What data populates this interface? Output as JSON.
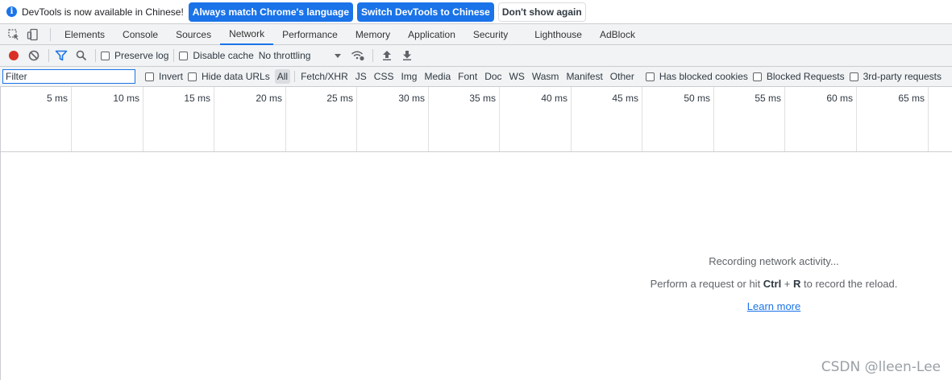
{
  "infobar": {
    "message": "DevTools is now available in Chinese!",
    "btn_match": "Always match Chrome's language",
    "btn_switch": "Switch DevTools to Chinese",
    "btn_dismiss": "Don't show again"
  },
  "tabs": [
    {
      "label": "Elements"
    },
    {
      "label": "Console"
    },
    {
      "label": "Sources"
    },
    {
      "label": "Network",
      "active": true
    },
    {
      "label": "Performance"
    },
    {
      "label": "Memory"
    },
    {
      "label": "Application"
    },
    {
      "label": "Security"
    },
    {
      "label": "Lighthouse"
    },
    {
      "label": "AdBlock"
    }
  ],
  "toolbar": {
    "preserve_log": "Preserve log",
    "disable_cache": "Disable cache",
    "throttling": "No throttling"
  },
  "filterbar": {
    "placeholder": "Filter",
    "invert": "Invert",
    "hide_data_urls": "Hide data URLs",
    "types": [
      "All",
      "Fetch/XHR",
      "JS",
      "CSS",
      "Img",
      "Media",
      "Font",
      "Doc",
      "WS",
      "Wasm",
      "Manifest",
      "Other"
    ],
    "selected_type": "All",
    "has_blocked_cookies": "Has blocked cookies",
    "blocked_requests": "Blocked Requests",
    "third_party": "3rd-party requests"
  },
  "timeline": {
    "ticks": [
      "5 ms",
      "10 ms",
      "15 ms",
      "20 ms",
      "25 ms",
      "30 ms",
      "35 ms",
      "40 ms",
      "45 ms",
      "50 ms",
      "55 ms",
      "60 ms",
      "65 ms"
    ]
  },
  "empty_state": {
    "recording": "Recording network activity...",
    "hint_prefix": "Perform a request or hit ",
    "ctrl": "Ctrl",
    "plus": " + ",
    "r": "R",
    "hint_suffix": " to record the reload.",
    "learn_more": "Learn more"
  },
  "watermark": "CSDN @lleen-Lee",
  "colors": {
    "accent": "#1a73e8",
    "record": "#d93025",
    "toolbar_bg": "#f1f3f4"
  }
}
